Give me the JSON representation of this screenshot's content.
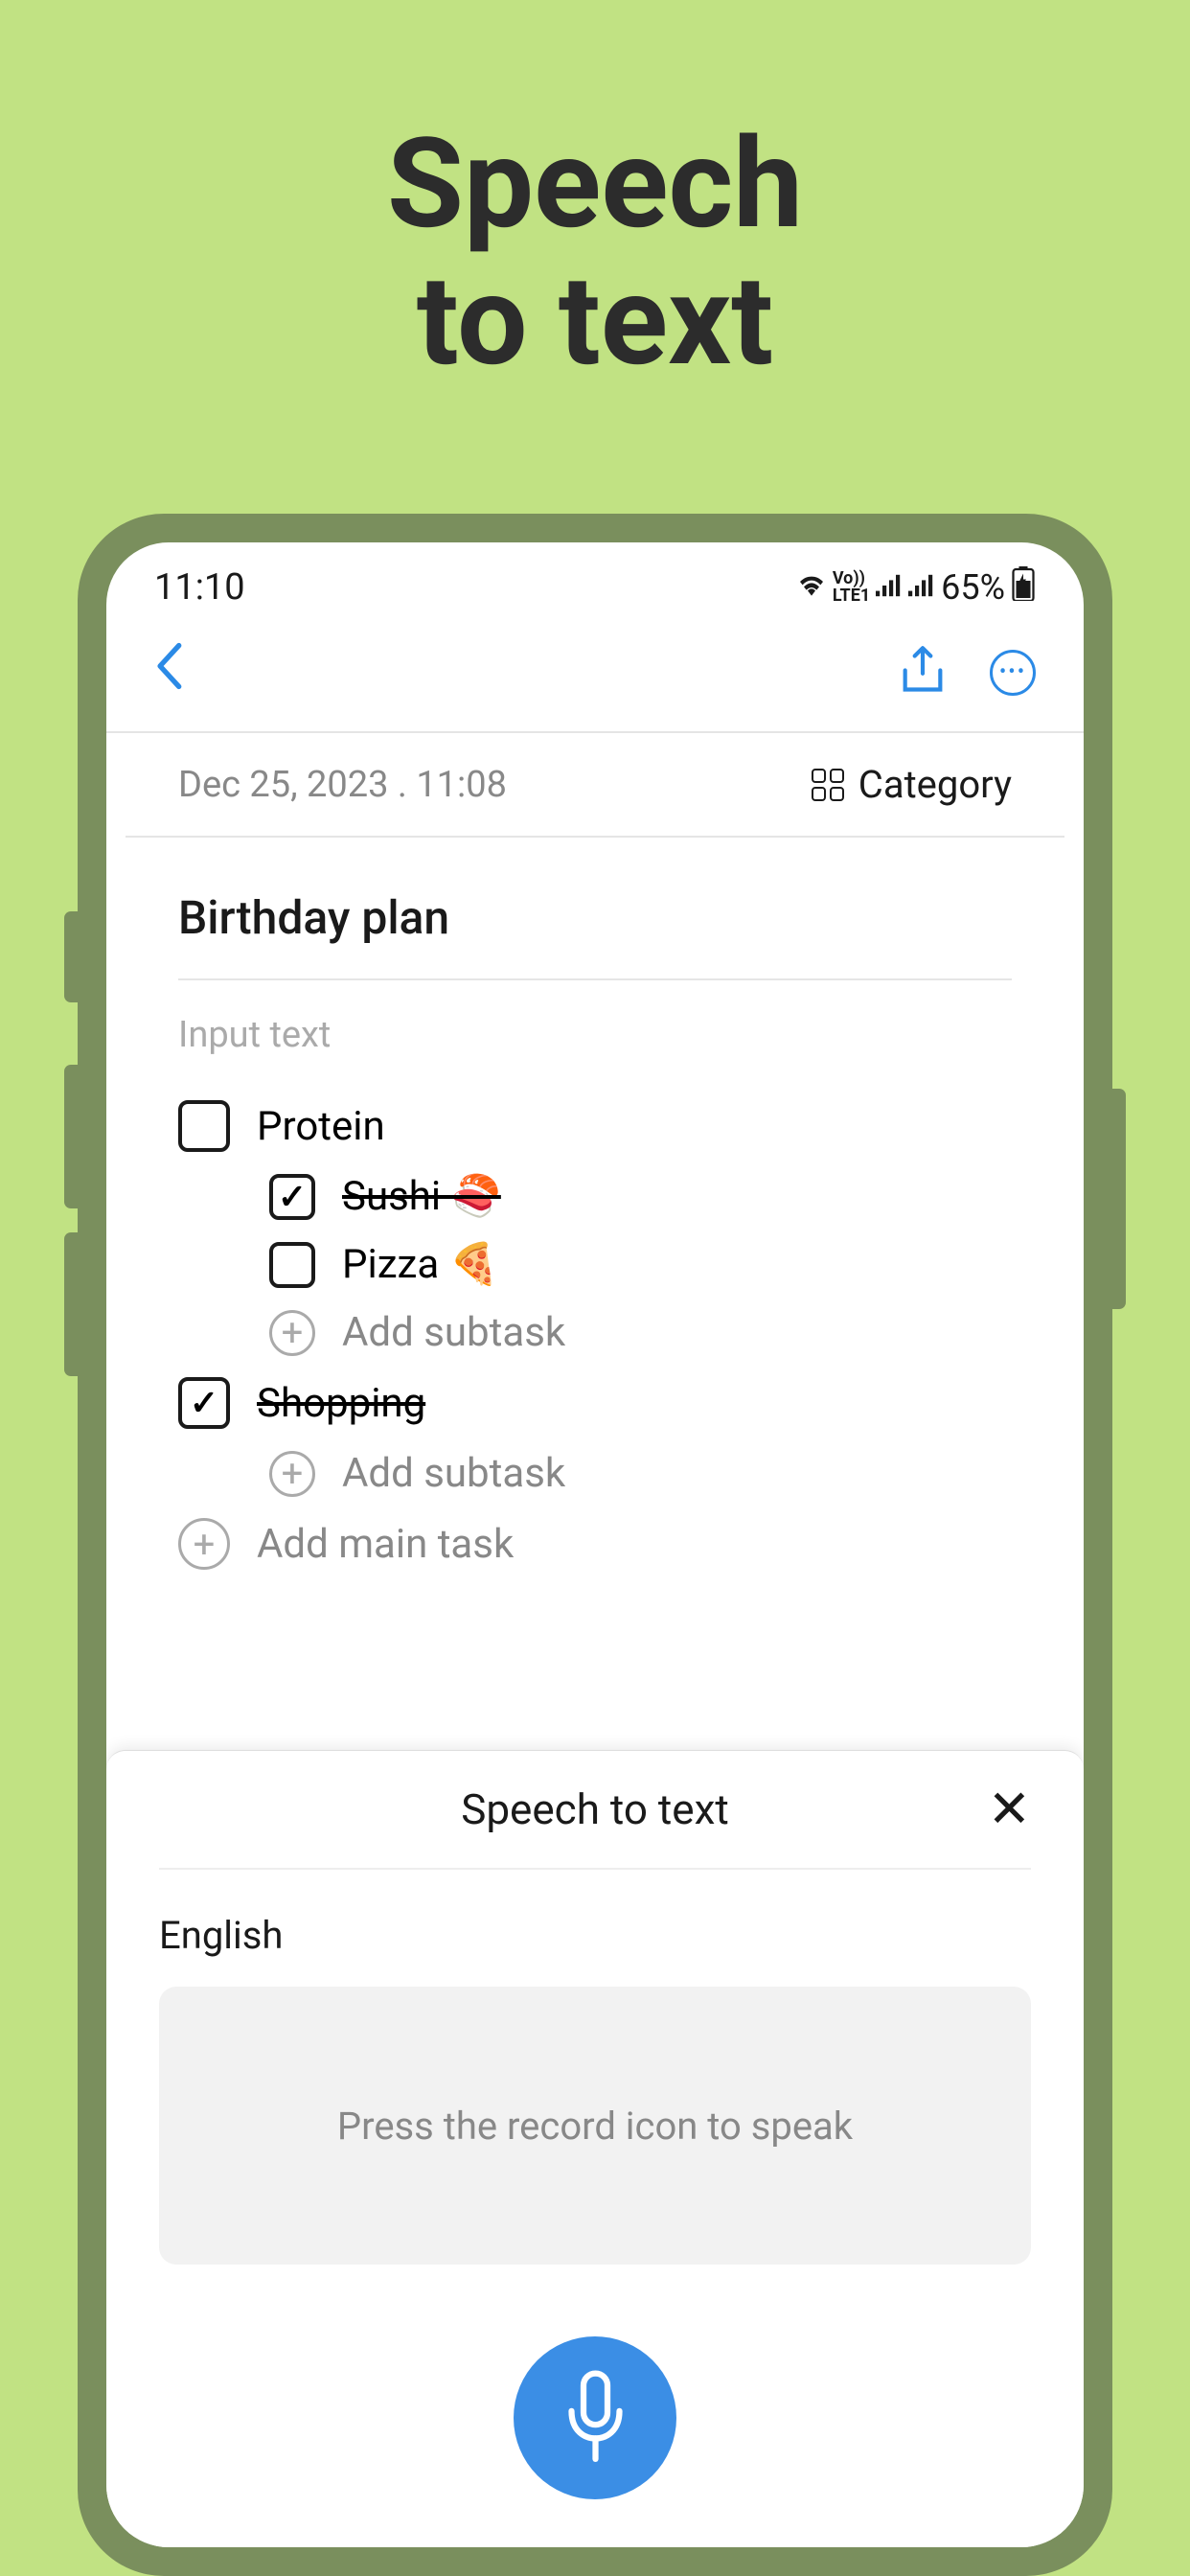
{
  "marketing": {
    "title_line1": "Speech",
    "title_line2": "to text"
  },
  "status": {
    "time": "11:10",
    "battery_text": "65%",
    "network": "LTE1"
  },
  "note": {
    "timestamp": "Dec 25, 2023 . 11:08",
    "category_label": "Category",
    "title": "Birthday plan",
    "input_label": "Input text"
  },
  "tasks": [
    {
      "label": "Protein",
      "done": false,
      "level": 0
    },
    {
      "label": "Sushi 🍣",
      "done": true,
      "level": 1
    },
    {
      "label": "Pizza 🍕",
      "done": false,
      "level": 1
    },
    {
      "label": "Add subtask",
      "type": "add",
      "level": 1
    },
    {
      "label": "Shopping",
      "done": true,
      "level": 0
    },
    {
      "label": "Add subtask",
      "type": "add",
      "level": 1
    },
    {
      "label": "Add main task",
      "type": "add",
      "level": 0
    }
  ],
  "sheet": {
    "title": "Speech to text",
    "language": "English",
    "prompt": "Press the record icon to speak"
  }
}
